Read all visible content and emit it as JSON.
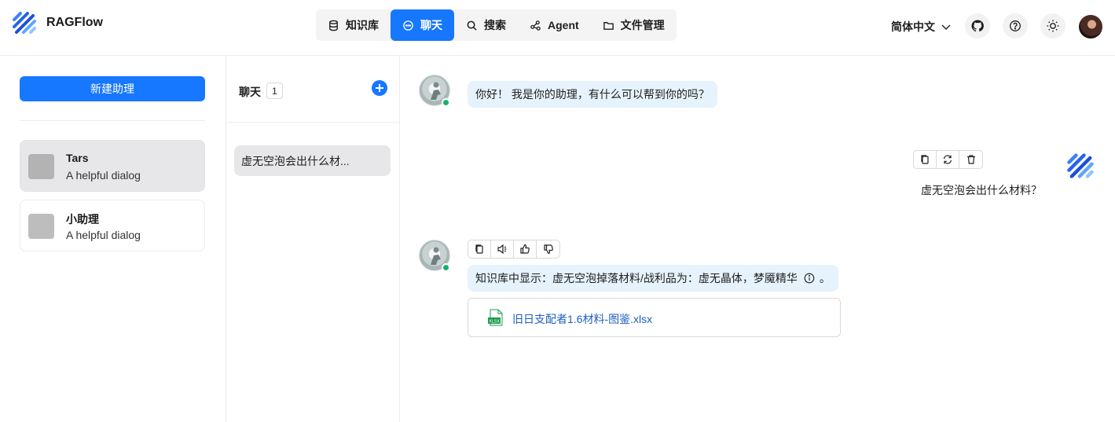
{
  "header": {
    "brand": "RAGFlow",
    "nav": [
      {
        "label": "知识库",
        "icon": "database-icon",
        "active": false
      },
      {
        "label": "聊天",
        "icon": "chat-icon",
        "active": true
      },
      {
        "label": "搜索",
        "icon": "search-icon",
        "active": false
      },
      {
        "label": "Agent",
        "icon": "agent-graph-icon",
        "active": false
      },
      {
        "label": "文件管理",
        "icon": "folder-icon",
        "active": false
      }
    ],
    "language": "简体中文",
    "icons": [
      "github-icon",
      "help-icon",
      "theme-sun-icon",
      "user-avatar"
    ]
  },
  "left_panel": {
    "new_assistant_label": "新建助理",
    "assistants": [
      {
        "name": "Tars",
        "description": "A helpful dialog",
        "selected": true
      },
      {
        "name": "小助理",
        "description": "A helpful dialog",
        "selected": false
      }
    ]
  },
  "middle_panel": {
    "title": "聊天",
    "count": "1",
    "conversations": [
      {
        "title": "虚无空泡会出什么材..."
      }
    ]
  },
  "chat": {
    "messages": [
      {
        "role": "assistant",
        "text": "你好！ 我是你的助理，有什么可以帮到你的吗？"
      },
      {
        "role": "user",
        "text": "虚无空泡会出什么材料？",
        "actions": [
          "copy-icon",
          "regenerate-icon",
          "delete-icon"
        ]
      },
      {
        "role": "assistant",
        "text": "知识库中显示：虚无空泡掉落材料/战利品为：虚无晶体，梦魇精华",
        "suffix": "。",
        "actions": [
          "copy-icon",
          "speaker-icon",
          "thumbs-up-icon",
          "thumbs-down-icon"
        ],
        "reference_file": "旧日支配者1.6材料-图鉴.xlsx",
        "reference_file_type": "XLSX"
      }
    ]
  },
  "colors": {
    "accent": "#1677ff",
    "bubble": "#e6f3fc",
    "online": "#17b26a"
  }
}
